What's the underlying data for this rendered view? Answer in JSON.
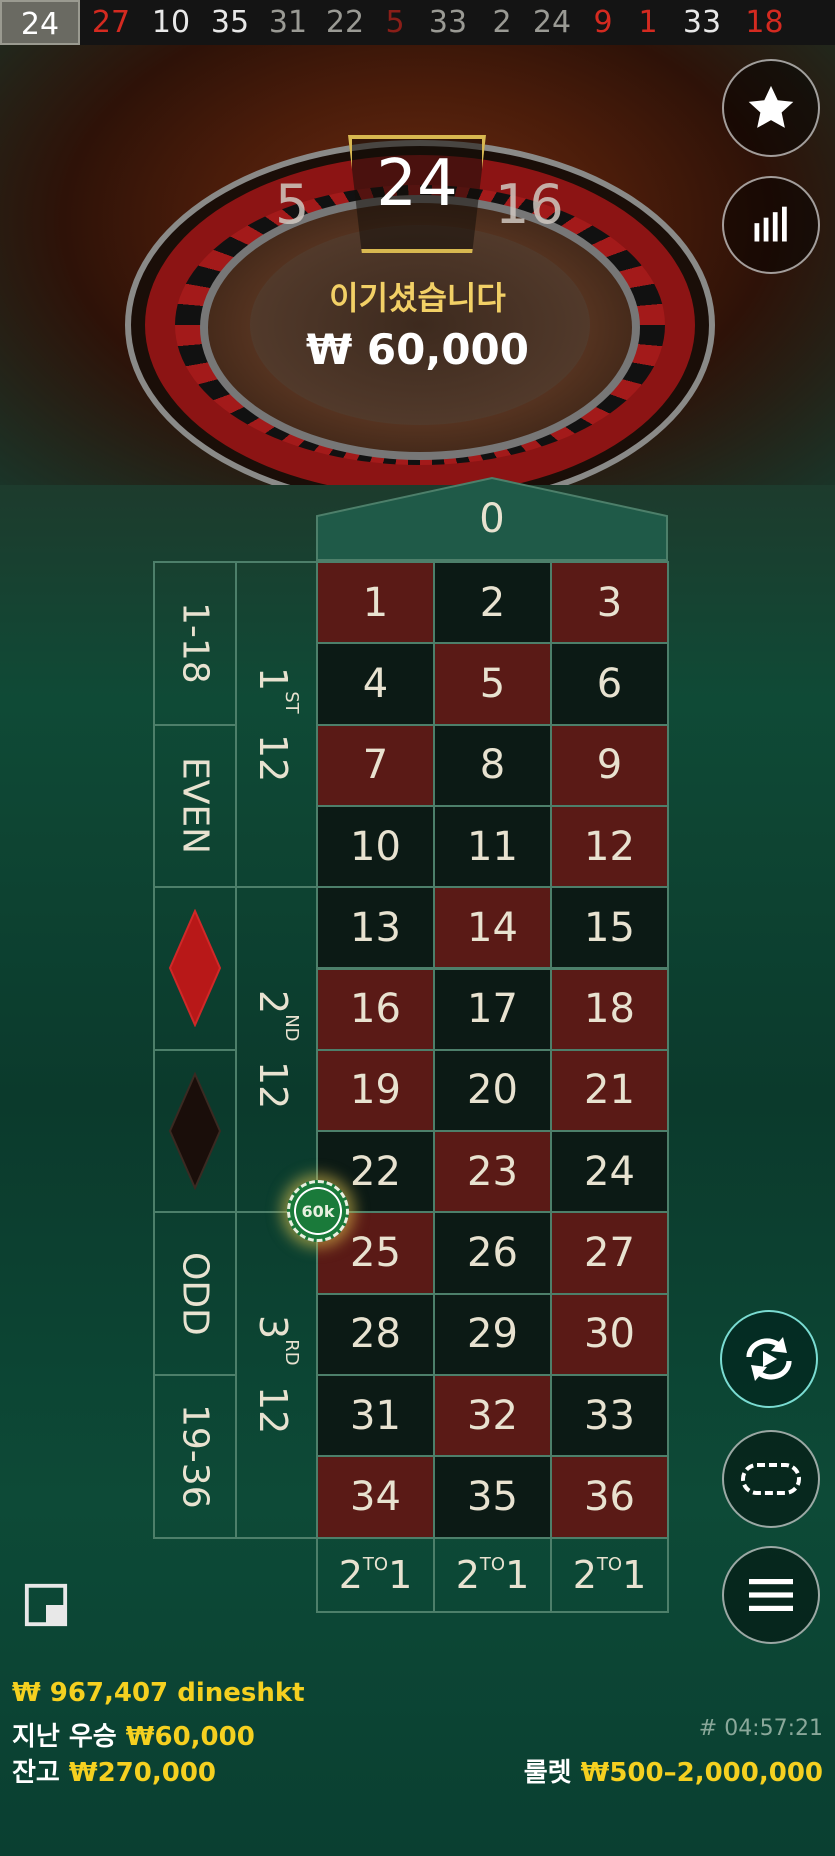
{
  "history": [
    {
      "n": "24",
      "style": "first"
    },
    {
      "n": "27",
      "style": "red"
    },
    {
      "n": "10",
      "style": "black"
    },
    {
      "n": "35",
      "style": "black"
    },
    {
      "n": "31",
      "style": "dim-black"
    },
    {
      "n": "22",
      "style": "dim-black"
    },
    {
      "n": "5",
      "style": "dim-red"
    },
    {
      "n": "33",
      "style": "dim-black"
    },
    {
      "n": "2",
      "style": "dim-black"
    },
    {
      "n": "24",
      "style": "dim-black"
    },
    {
      "n": "9",
      "style": "red"
    },
    {
      "n": "1",
      "style": "red"
    },
    {
      "n": "33",
      "style": "black"
    },
    {
      "n": "18",
      "style": "red"
    }
  ],
  "wheel": {
    "result": "24",
    "prev": "5",
    "next": "16",
    "win_label": "이기셨습니다",
    "win_amount": "₩ 60,000"
  },
  "buttons": {
    "favorite_icon": "star-icon",
    "stats_icon": "statistics-icon",
    "repeat_icon": "repeat-bet-icon",
    "chip_icon": "chip-stack-icon",
    "menu_icon": "menu-icon"
  },
  "table": {
    "zero": "0",
    "reds": [
      1,
      3,
      5,
      7,
      9,
      12,
      14,
      16,
      18,
      19,
      21,
      23,
      25,
      27,
      30,
      32,
      34,
      36
    ],
    "rows": [
      [
        "1",
        "2",
        "3"
      ],
      [
        "4",
        "5",
        "6"
      ],
      [
        "7",
        "8",
        "9"
      ],
      [
        "10",
        "11",
        "12"
      ],
      [
        "13",
        "14",
        "15"
      ],
      [
        "16",
        "17",
        "18"
      ],
      [
        "19",
        "20",
        "21"
      ],
      [
        "22",
        "23",
        "24"
      ],
      [
        "25",
        "26",
        "27"
      ],
      [
        "28",
        "29",
        "30"
      ],
      [
        "31",
        "32",
        "33"
      ],
      [
        "34",
        "35",
        "36"
      ]
    ],
    "dozens": [
      {
        "num": "1",
        "sup": "ST",
        "label": "12"
      },
      {
        "num": "2",
        "sup": "ND",
        "label": "12"
      },
      {
        "num": "3",
        "sup": "RD",
        "label": "12"
      }
    ],
    "outside": [
      "1-18",
      "EVEN",
      "",
      "",
      "ODD",
      "19-36"
    ],
    "columns": [
      {
        "num": "2",
        "sup": "TO",
        "label": "1"
      },
      {
        "num": "2",
        "sup": "TO",
        "label": "1"
      },
      {
        "num": "2",
        "sup": "TO",
        "label": "1"
      }
    ],
    "chip_value": "60k",
    "colors": {
      "red": "#5a1a16",
      "black": "#0c1a15",
      "diamond_red": "#b81818",
      "diamond_black": "#1a0e0a"
    }
  },
  "footer": {
    "balance_line": "₩ 967,407 dineshkt",
    "last_win_label": "지난 우승",
    "last_win_value": "₩60,000",
    "total_bet_label": "잔고",
    "total_bet_value": "₩270,000",
    "game_id": "# 04:57:21",
    "game_name": "룰렛",
    "limits": "₩500–2,000,000"
  }
}
